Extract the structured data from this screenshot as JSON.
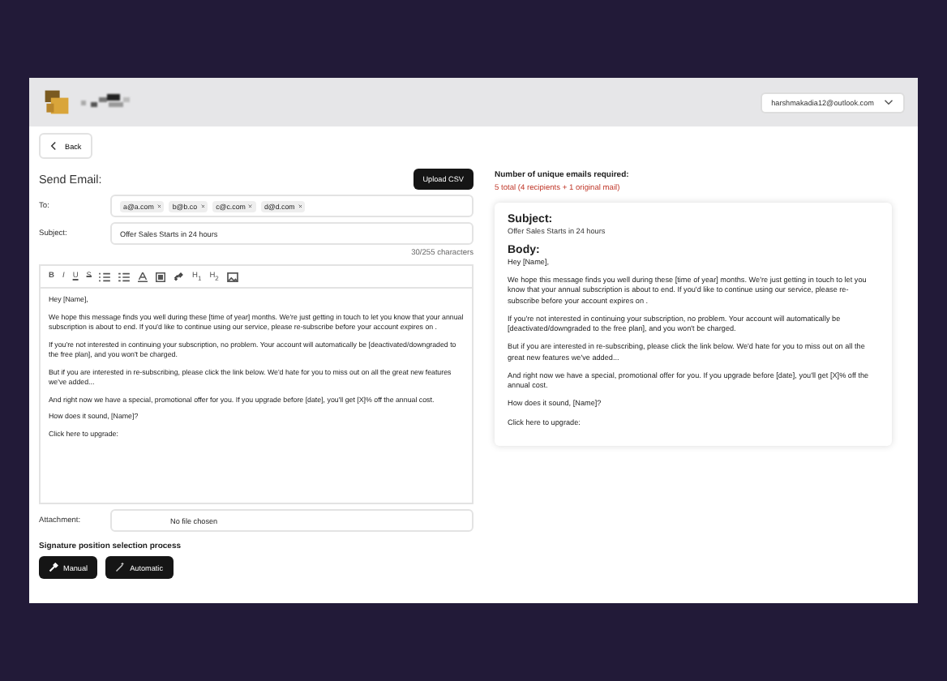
{
  "header": {
    "account": "harshmakadia12@outlook.com"
  },
  "back_button": "Back",
  "title": "Send Email:",
  "upload_button": "Upload CSV",
  "to": {
    "label": "To:",
    "recipients": [
      "a@a.com",
      "b@b.co",
      "c@c.com",
      "d@d.com"
    ]
  },
  "subject": {
    "label": "Subject:",
    "value": "Offer Sales Starts in 24 hours",
    "counter": "30/255 characters"
  },
  "toolbar": [
    {
      "kind": "bold",
      "label": "B"
    },
    {
      "kind": "italic",
      "label": "I"
    },
    {
      "kind": "underline",
      "label": "U"
    },
    {
      "kind": "strike",
      "label": "S"
    },
    {
      "kind": "bullets"
    },
    {
      "kind": "numbers"
    },
    {
      "kind": "color"
    },
    {
      "kind": "highlight"
    },
    {
      "kind": "link"
    },
    {
      "kind": "heading",
      "label": "H$_{1}$"
    },
    {
      "kind": "heading",
      "label": "H$_{2}$"
    },
    {
      "kind": "image"
    }
  ],
  "editor_paragraphs": [
    "Hey [Name],",
    "We hope this message finds you well during these [time of year] months. We're just getting in touch to let you know that your annual subscription is about to end. If you'd like to continue using our service, please re-subscribe before your account expires on .",
    "If you're not interested in continuing your subscription, no problem. Your account will automatically be [deactivated/downgraded to the free plan], and you won't be charged.",
    "But if you are interested in re-subscribing, please click the link below. We'd hate for you to miss out on all the great new features we've added...",
    "And right now we have a special, promotional offer for you. If you upgrade before [date], you'll get [X]% off the annual cost.",
    "How does it sound, [Name]?",
    "Click here to upgrade:"
  ],
  "attachment": {
    "label": "Attachment:",
    "value": "No file chosen"
  },
  "signature": {
    "heading": "Signature position selection process",
    "buttons": [
      {
        "kind": "manual",
        "label": "Manual"
      },
      {
        "kind": "automatic",
        "label": "Automatic"
      }
    ]
  },
  "summary": {
    "heading": "Number of unique emails required:",
    "count": "5 total (4 recipients + 1 original mail)"
  },
  "preview": {
    "subject_heading": "Subject:",
    "subject": "Offer Sales Starts in 24 hours",
    "body_heading": "Body:",
    "paragraphs": [
      "Hey [Name],",
      "We hope this message finds you well during these [time of year] months. We're just getting in touch to let you know that your annual subscription is about to end. If you'd like to continue using our service, please re-subscribe before your account expires on .",
      "If you're not interested in continuing your subscription, no problem. Your account will automatically be [deactivated/downgraded to the free plan], and you won't be charged.",
      "But if you are interested in re-subscribing, please click the link below. We'd hate for you to miss out on all the great new features we've added...",
      "And right now we have a special, promotional offer for you. If you upgrade before [date], you'll get [X]% off the annual cost.",
      "How does it sound, [Name]?",
      "Click here to upgrade:"
    ]
  }
}
